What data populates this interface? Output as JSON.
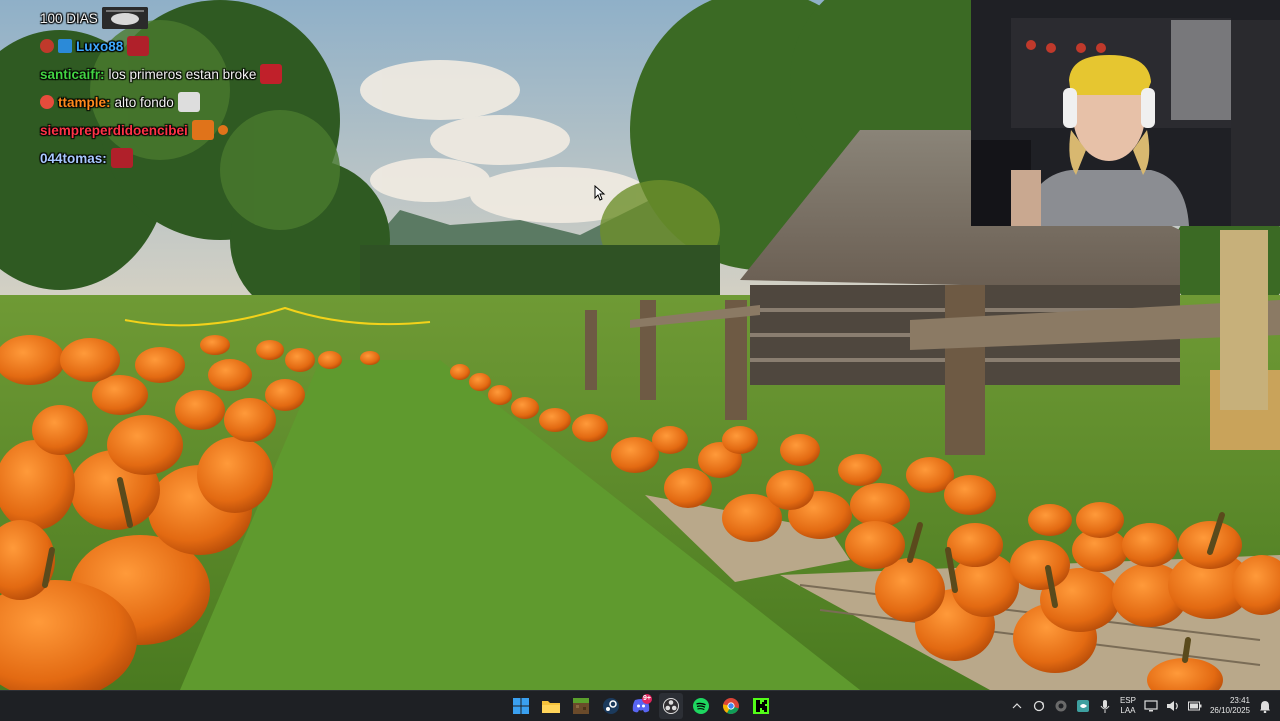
{
  "chat": {
    "messages": [
      {
        "user": "",
        "text": "100 DIAS",
        "user_color": "#ffffff"
      },
      {
        "user": "Luxo88",
        "text": "",
        "user_color": "#3fa9ff"
      },
      {
        "user": "santicaifr:",
        "text": "los primeros estan broke",
        "user_color": "#43d443"
      },
      {
        "user": "ttample:",
        "text": "alto fondo",
        "user_color": "#ff8a1c"
      },
      {
        "user": "siempreperdidoencibei",
        "text": "",
        "user_color": "#ff3347"
      },
      {
        "user": "044tomas:",
        "text": "",
        "user_color": "#a8c8ff"
      }
    ]
  },
  "taskbar": {
    "apps": [
      {
        "name": "windows-start",
        "icon": "windows-logo-icon"
      },
      {
        "name": "file-explorer",
        "icon": "folder-icon"
      },
      {
        "name": "minecraft",
        "icon": "minecraft-icon"
      },
      {
        "name": "steam",
        "icon": "steam-icon"
      },
      {
        "name": "discord",
        "icon": "discord-icon",
        "badge": "9+"
      },
      {
        "name": "obs",
        "icon": "obs-icon"
      },
      {
        "name": "spotify",
        "icon": "spotify-icon"
      },
      {
        "name": "chrome",
        "icon": "chrome-icon"
      },
      {
        "name": "kick",
        "icon": "kick-icon"
      }
    ],
    "language": {
      "line1": "ESP",
      "line2": "LAA"
    },
    "clock": {
      "time": "23:41",
      "date": "26/10/2025"
    }
  },
  "colors": {
    "taskbar_bg": "#1e2024",
    "pumpkin": "#e8731c",
    "grass": "#5a8a2c",
    "sky": "#a9c3d6"
  }
}
